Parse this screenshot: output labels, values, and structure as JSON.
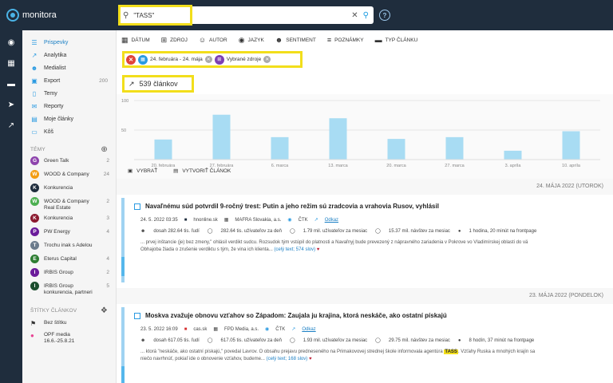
{
  "app": {
    "logo_text": "monitora",
    "brand_color": "#4bb3e6",
    "topbar_color": "#1f2d3d"
  },
  "search": {
    "value": "\"TASS\"",
    "search_icon": "search-icon",
    "clear_icon": "close-icon"
  },
  "sidebar": {
    "nav": [
      {
        "label": "Prispevky",
        "icon": "list-icon",
        "active": true
      },
      {
        "label": "Analytika",
        "icon": "trend-icon"
      },
      {
        "label": "Medialist",
        "icon": "people-icon"
      },
      {
        "label": "Export",
        "icon": "export-icon",
        "count": "200"
      },
      {
        "label": "Temy",
        "icon": "bookmark-icon"
      },
      {
        "label": "Reporty",
        "icon": "mail-icon"
      },
      {
        "label": "Moje články",
        "icon": "article-icon"
      },
      {
        "label": "Kôš",
        "icon": "trash-icon"
      }
    ],
    "topics_header": "TÉMY",
    "topics": [
      {
        "initial": "G",
        "name": "Green Talk",
        "count": "2",
        "color": "#8e44ad"
      },
      {
        "initial": "W",
        "name": "WOOD & Company",
        "count": "24",
        "color": "#f39c12"
      },
      {
        "initial": "K",
        "name": "Konkurencia",
        "count": "",
        "color": "#1f2d3d"
      },
      {
        "initial": "W",
        "name": "WOOD & Company Real Estate",
        "count": "2",
        "color": "#4caf50"
      },
      {
        "initial": "K",
        "name": "Konkurencia",
        "count": "3",
        "color": "#8b1a2f"
      },
      {
        "initial": "P",
        "name": "PW Energy",
        "count": "4",
        "color": "#6a1b9a"
      },
      {
        "initial": "T",
        "name": "Trochu inak s Adelou",
        "count": "",
        "color": "#6b7b8c"
      },
      {
        "initial": "E",
        "name": "Eterus Capital",
        "count": "4",
        "color": "#2e7d32"
      },
      {
        "initial": "I",
        "name": "IRBIS Group",
        "count": "2",
        "color": "#6a1b9a"
      },
      {
        "initial": "I",
        "name": "IRBIS Group konkurencia, partneri",
        "count": "5",
        "color": "#1b4d2e"
      }
    ],
    "tags_header": "ŠTÍTKY ČLÁNKOV",
    "tags": [
      {
        "name": "Bez štítku",
        "icon": "tag-icon"
      },
      {
        "name": "OPF media 16.6.-25.8.21",
        "icon": "tag-pink-icon"
      }
    ]
  },
  "toolbar": {
    "items": [
      {
        "label": "DÁTUM",
        "icon": "calendar-icon"
      },
      {
        "label": "ZDROJ",
        "icon": "source-icon"
      },
      {
        "label": "AUTOR",
        "icon": "author-icon"
      },
      {
        "label": "JAZYK",
        "icon": "globe-icon"
      },
      {
        "label": "SENTIMENT",
        "icon": "smile-icon"
      },
      {
        "label": "POZNÁMKY",
        "icon": "note-icon"
      },
      {
        "label": "TYP ČLÁNKU",
        "icon": "type-icon"
      }
    ]
  },
  "filters": {
    "date_range": "24. februára - 24. mája",
    "sources": "Vybrané zdroje"
  },
  "result_count": "539 článkov",
  "chart_data": {
    "type": "bar",
    "categories": [
      "20. februára",
      "27. februára",
      "6. marca",
      "13. marca",
      "20. marca",
      "27. marca",
      "3. apríla",
      "10. apríla"
    ],
    "values": [
      34,
      76,
      38,
      70,
      35,
      38,
      15,
      48
    ],
    "ylim": [
      0,
      100
    ],
    "yticks": [
      50,
      100
    ],
    "bar_color": "#a8dcf3",
    "grid": true
  },
  "actions": {
    "select_label": "VYBRAŤ",
    "create_label": "VYTVORIŤ ČLÁNOK"
  },
  "groups": [
    {
      "date_label": "24. MÁJA 2022 (UTOROK)",
      "article": {
        "title": "Navaľnému súd potvrdil 9-ročný trest: Putin a jeho režim sú zradcovia a vrahovia Rusov, vyhlásil",
        "timestamp": "24. 5. 2022 03:35",
        "source": "hnonline.sk",
        "publisher": "MAFRA Slovakia, a.s.",
        "agency": "ČTK",
        "link": "Odkaz",
        "reach": "dosah 282.64 tis. ľudí",
        "daily": "282.64 tis. užívateľov za deň",
        "monthly": "1.79 mil. užívateľov za mesiac",
        "visits": "15.37 mil. návštev za mesiac",
        "frontpage": "1 hodina, 20 minút na frontpage",
        "snippet_before": "... prvej inštancie (je) bez zmeny,\" ohlásil verdikt sudcu. Rozsudok tým vstúpil do platnosti a Navaľnyj bude prevezený z nápravného zariadenia v Pokrove vo Vladimírskej oblasti do vä",
        "snippet_line2": "Obhajoba žiada o zrušenie verdiktu s tým, že vina ich klienta...",
        "snippet_highlight": "",
        "more": "(celý text; 574 slov)"
      }
    },
    {
      "date_label": "23. MÁJA 2022 (PONDELOK)",
      "article": {
        "title": "Moskva zvažuje obnovu vzťahov so Západom: Zaujala ju krajina, ktorá neskáče, ako ostatní pískajú",
        "timestamp": "23. 5. 2022 16:09",
        "source": "cas.sk",
        "publisher": "FPD Media, a.s.",
        "agency": "ČTK",
        "link": "Odkaz",
        "reach": "dosah 617.05 tis. ľudí",
        "daily": "617.05 tis. užívateľov za deň",
        "monthly": "1.93 mil. užívateľov za mesiac",
        "visits": "29.75 mil. návštev za mesiac",
        "frontpage": "8 hodín, 37 minút na frontpage",
        "snippet_before": "... ktorá \"neskáče, ako ostatní pískajú,\" povedal Lavrov. O obsahu prejavu predneseného na Primakovovej strednej škole informovala agentúra",
        "snippet_line2": "niečo navrhnúť, pokiaľ ide o obnovenie vzťahov, budeme...",
        "snippet_highlight": "TASS",
        "snippet_after": ". Vzťahy Ruska a mnohých krajín sa",
        "more": "(celý text; 168 slov)"
      }
    }
  ]
}
